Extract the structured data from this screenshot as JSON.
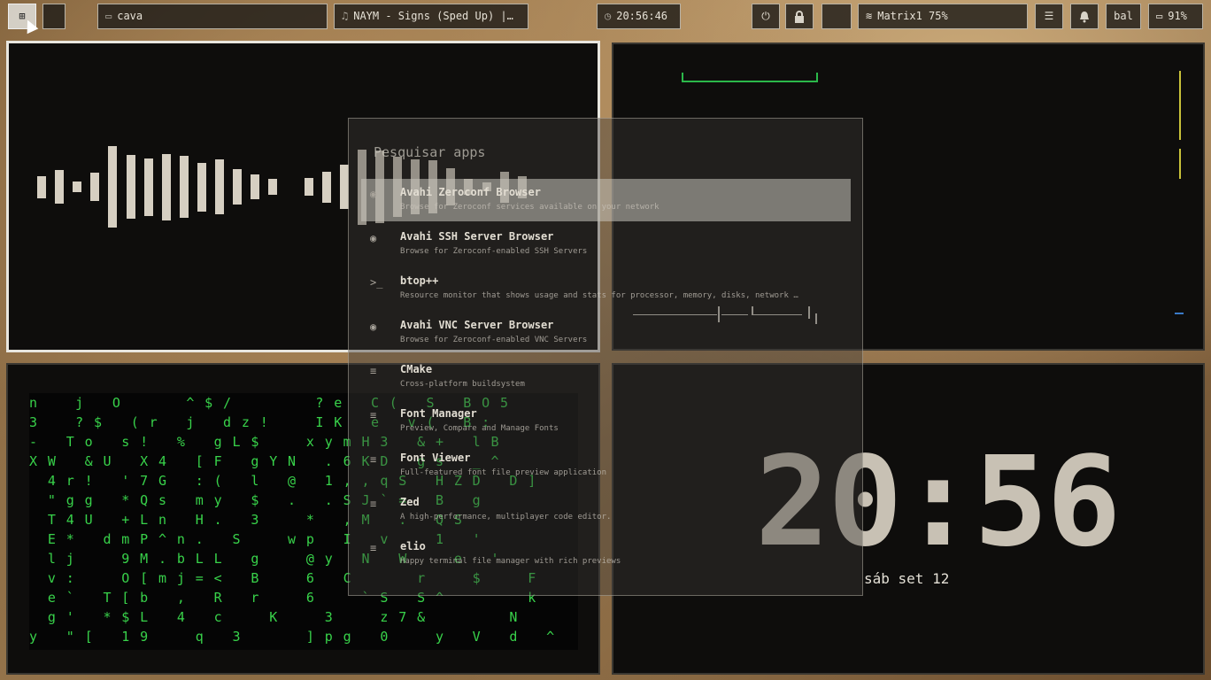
{
  "topbar": {
    "workspaces": [
      {
        "label": "⊞"
      },
      {
        "label": ""
      }
    ],
    "window_title": "cava",
    "media": "NAYM - Signs (Sped Up) |…",
    "clock": "20:56:46",
    "wifi": "Matrix1  75%",
    "keyboard_layout": "bal",
    "battery": "91%"
  },
  "launcher": {
    "search_placeholder": "Pesquisar apps",
    "apps": [
      {
        "name": "Avahi Zeroconf Browser",
        "desc": "Browse for Zeroconf services available on your network",
        "icon": "globe-icon"
      },
      {
        "name": "Avahi SSH Server Browser",
        "desc": "Browse for Zeroconf-enabled SSH Servers",
        "icon": "globe-icon"
      },
      {
        "name": "btop++",
        "desc": "Resource monitor that shows usage and stats for processor, memory, disks, network …",
        "icon": "terminal-icon"
      },
      {
        "name": "Avahi VNC Server Browser",
        "desc": "Browse for Zeroconf-enabled VNC Servers",
        "icon": "globe-icon"
      },
      {
        "name": "CMake",
        "desc": "Cross-platform buildsystem",
        "icon": "list-icon"
      },
      {
        "name": "Font Manager",
        "desc": "Preview, Compare and Manage Fonts",
        "icon": "list-icon"
      },
      {
        "name": "Font Viewer",
        "desc": "Full-featured font file preview application",
        "icon": "list-icon"
      },
      {
        "name": "Zed",
        "desc": "A high-performance, multiplayer code editor.",
        "icon": "list-icon"
      },
      {
        "name": "elio",
        "desc": "Happy terminal file manager with rich previews",
        "icon": "list-icon"
      }
    ]
  },
  "clock_window": {
    "time": "20:56",
    "date": "sáb set 12"
  },
  "cava": {
    "bar_levels": [
      0.25,
      0.38,
      0.12,
      0.32,
      0.92,
      0.72,
      0.65,
      0.75,
      0.7,
      0.55,
      0.62,
      0.4,
      0.28,
      0.18,
      0,
      0.2,
      0.35,
      0.5,
      0.85,
      0.82,
      0.68,
      0.62,
      0.6,
      0.42,
      0.18,
      0.1,
      0.35,
      0.25
    ]
  },
  "matrix_rows": [
    "n    j   O       ^ $ /         ? e   C (   S   B O 5",
    "3    ? $   ( r   j   d z !     I K   e   v (   B :",
    "-   T o   s !   %   g L $     x y m H 3   & +   l B",
    "X W   & U   X 4   [ F   g Y N   . 6 K D   g s   _ ^",
    "  4 r !   ' 7 G   : (   l   @   1 , , q S   H Z D   D ]",
    "  \" g g   * Q s   m y   $   .   . S J ` =   B   g",
    "  T 4 U   + L n   H .   3     *   , M   .   Q S",
    "  E *   d m P ^ n .   S     w p   I   v     1   '",
    "  l j     9 M . b L L   g     @ y   N   W     e   '",
    "  v :     O [ m j = <   B     6   C       r     $     F",
    "  e `   T [ b   ,   R   r     6     ` S   S ^         k",
    "  g '   * $ L   4   c     K     3     z 7 &         N",
    "y   \" [   1 9     q   3       ] p g   0     y   V   d   ^"
  ]
}
